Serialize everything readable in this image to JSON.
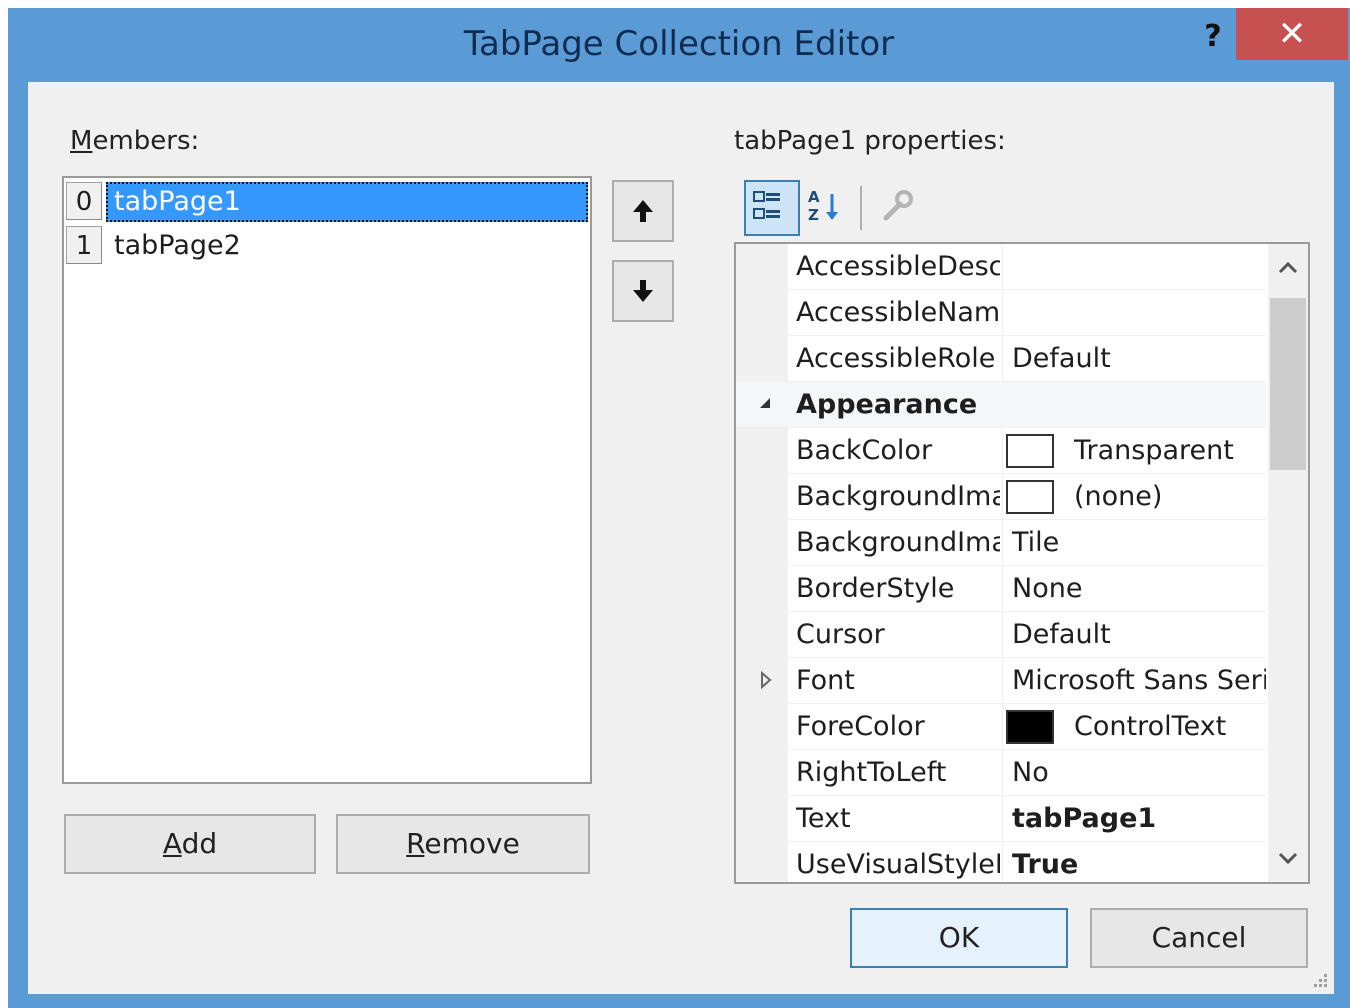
{
  "window": {
    "title": "TabPage Collection Editor",
    "help_label": "?",
    "close_label": "✕"
  },
  "members": {
    "label": "Members:",
    "items": [
      {
        "index": "0",
        "name": "tabPage1",
        "selected": true
      },
      {
        "index": "1",
        "name": "tabPage2",
        "selected": false
      }
    ],
    "add_label": "Add",
    "remove_label": "Remove"
  },
  "properties": {
    "label": "tabPage1 properties:",
    "toolbar": [
      "categorized-icon",
      "alphabetical-icon",
      "property-pages-icon"
    ],
    "rows": [
      {
        "name": "AccessibleDescr",
        "value": ""
      },
      {
        "name": "AccessibleNam",
        "value": ""
      },
      {
        "name": "AccessibleRole",
        "value": "Default"
      },
      {
        "name": "Appearance",
        "category": true
      },
      {
        "name": "BackColor",
        "value": "Transparent",
        "swatch": "#ffffff"
      },
      {
        "name": "BackgroundIma",
        "value": "(none)",
        "swatch": "#ffffff"
      },
      {
        "name": "BackgroundIma",
        "value": "Tile"
      },
      {
        "name": "BorderStyle",
        "value": "None"
      },
      {
        "name": "Cursor",
        "value": "Default"
      },
      {
        "name": "Font",
        "value": "Microsoft Sans Serif,",
        "expandable": true
      },
      {
        "name": "ForeColor",
        "value": "ControlText",
        "swatch": "#000000"
      },
      {
        "name": "RightToLeft",
        "value": "No"
      },
      {
        "name": "Text",
        "value": "tabPage1",
        "bold": true
      },
      {
        "name": "UseVisualStyleB",
        "value": "True",
        "bold": true
      }
    ]
  },
  "footer": {
    "ok_label": "OK",
    "cancel_label": "Cancel"
  },
  "colors": {
    "title_bar": "#5b9bd5",
    "close_button": "#c75050",
    "selection": "#3399ff"
  }
}
